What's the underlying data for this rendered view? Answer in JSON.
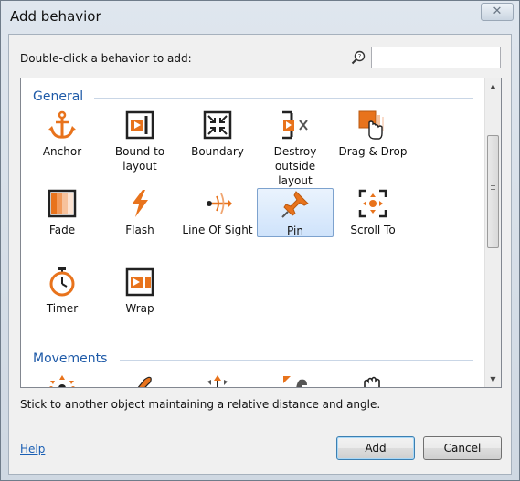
{
  "window": {
    "title": "Add behavior",
    "close_glyph": "✕"
  },
  "search": {
    "instruction": "Double-click a behavior to add:",
    "value": "",
    "placeholder": ""
  },
  "groups": [
    {
      "label": "General",
      "items": [
        {
          "label": "Anchor",
          "icon": "anchor-icon"
        },
        {
          "label": "Bound to layout",
          "icon": "bound-to-layout-icon"
        },
        {
          "label": "Boundary",
          "icon": "boundary-icon"
        },
        {
          "label": "Destroy outside layout",
          "icon": "destroy-outside-layout-icon"
        },
        {
          "label": "Drag & Drop",
          "icon": "drag-drop-icon"
        },
        {
          "label": "Fade",
          "icon": "fade-icon"
        },
        {
          "label": "Flash",
          "icon": "flash-icon"
        },
        {
          "label": "Line Of Sight",
          "icon": "line-of-sight-icon"
        },
        {
          "label": "Pin",
          "icon": "pin-icon",
          "selected": true
        },
        {
          "label": "Scroll To",
          "icon": "scroll-to-icon"
        },
        {
          "label": "Timer",
          "icon": "timer-icon"
        },
        {
          "label": "Wrap",
          "icon": "wrap-icon"
        }
      ]
    },
    {
      "label": "Movements",
      "items": []
    }
  ],
  "description": "Stick to another object maintaining a relative distance and angle.",
  "footer": {
    "help": "Help",
    "add": "Add",
    "cancel": "Cancel"
  },
  "colors": {
    "accent": "#e8731c",
    "group_heading": "#1e5aa8",
    "selection": "#cfe3fb"
  }
}
